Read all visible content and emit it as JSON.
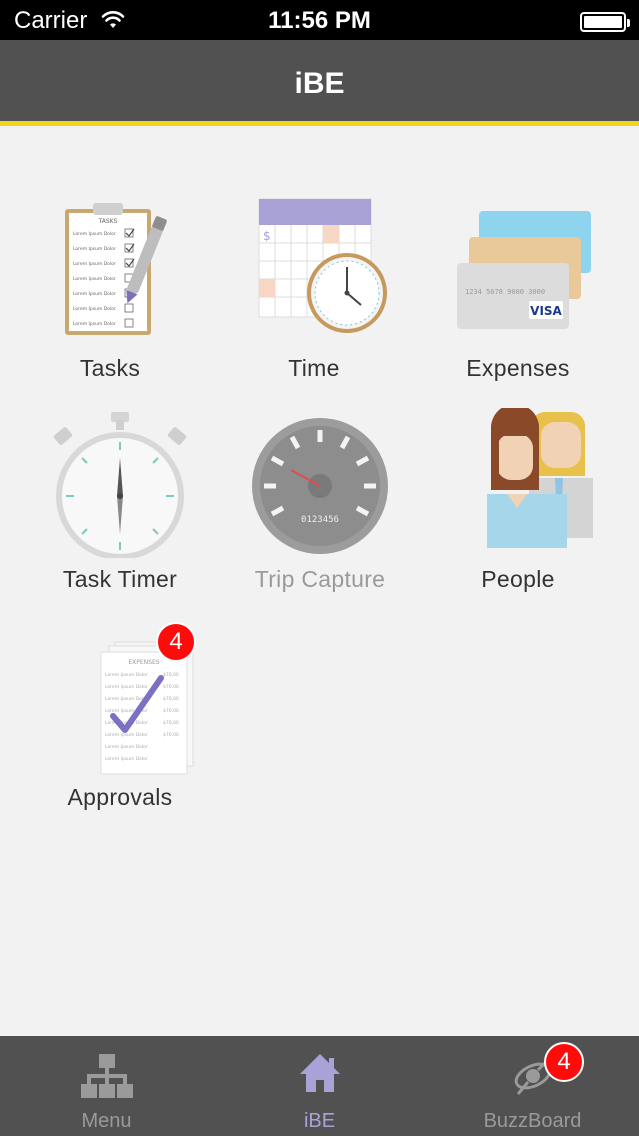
{
  "status_bar": {
    "carrier": "Carrier",
    "time": "11:56 PM"
  },
  "nav": {
    "title": "iBE"
  },
  "tiles": [
    {
      "label": "Tasks",
      "icon": "clipboard-icon",
      "enabled": true
    },
    {
      "label": "Time",
      "icon": "calendar-clock-icon",
      "enabled": true
    },
    {
      "label": "Expenses",
      "icon": "credit-cards-icon",
      "enabled": true
    },
    {
      "label": "Task Timer",
      "icon": "stopwatch-icon",
      "enabled": true
    },
    {
      "label": "Trip Capture",
      "icon": "speedometer-icon",
      "enabled": false
    },
    {
      "label": "People",
      "icon": "people-icon",
      "enabled": true
    },
    {
      "label": "Approvals",
      "icon": "approval-documents-icon",
      "enabled": true,
      "badge": "4"
    }
  ],
  "icon_text": {
    "tasks_header": "TASKS",
    "task_item": "Lorem Ipsum Dolor",
    "calendar_currency": "$",
    "card_number": "1234 5678 9000 3000",
    "card_brand": "VISA",
    "odometer": "0123456",
    "expenses_header": "EXPENSES",
    "expense_amount": "$70.00"
  },
  "tab_bar": {
    "tabs": [
      {
        "label": "Menu",
        "icon": "sitemap-icon",
        "active": false
      },
      {
        "label": "iBE",
        "icon": "home-icon",
        "active": true
      },
      {
        "label": "BuzzBoard",
        "icon": "satellite-icon",
        "active": false,
        "badge": "4"
      }
    ]
  },
  "colors": {
    "accent": "#f2d41a",
    "nav_bg": "#525152",
    "badge": "#ff0b0b",
    "active_tab": "#a9a2d6"
  }
}
